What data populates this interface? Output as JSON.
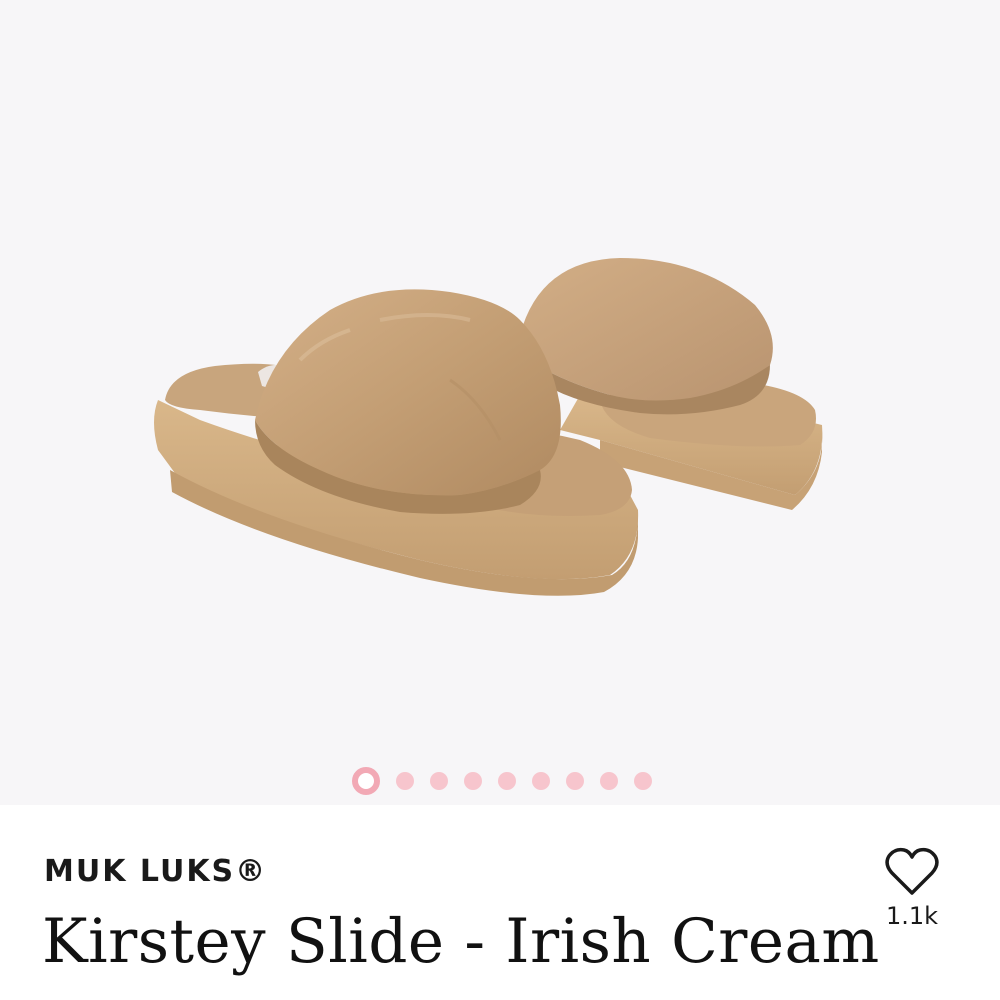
{
  "product": {
    "brand": "MUK LUKS®",
    "title": "Kirstey Slide - Irish Cream",
    "likes": "1.1k"
  },
  "gallery": {
    "image_count": 9,
    "active_index": 0
  },
  "icons": {
    "like": "heart-outline-icon"
  },
  "colors": {
    "gallery_background": "#f7f6f8",
    "dot": "#f7c5cd",
    "dot_active": "#f2a9b5",
    "text": "#111111",
    "fur": "#c9a57b",
    "sole": "#d1ad80"
  }
}
